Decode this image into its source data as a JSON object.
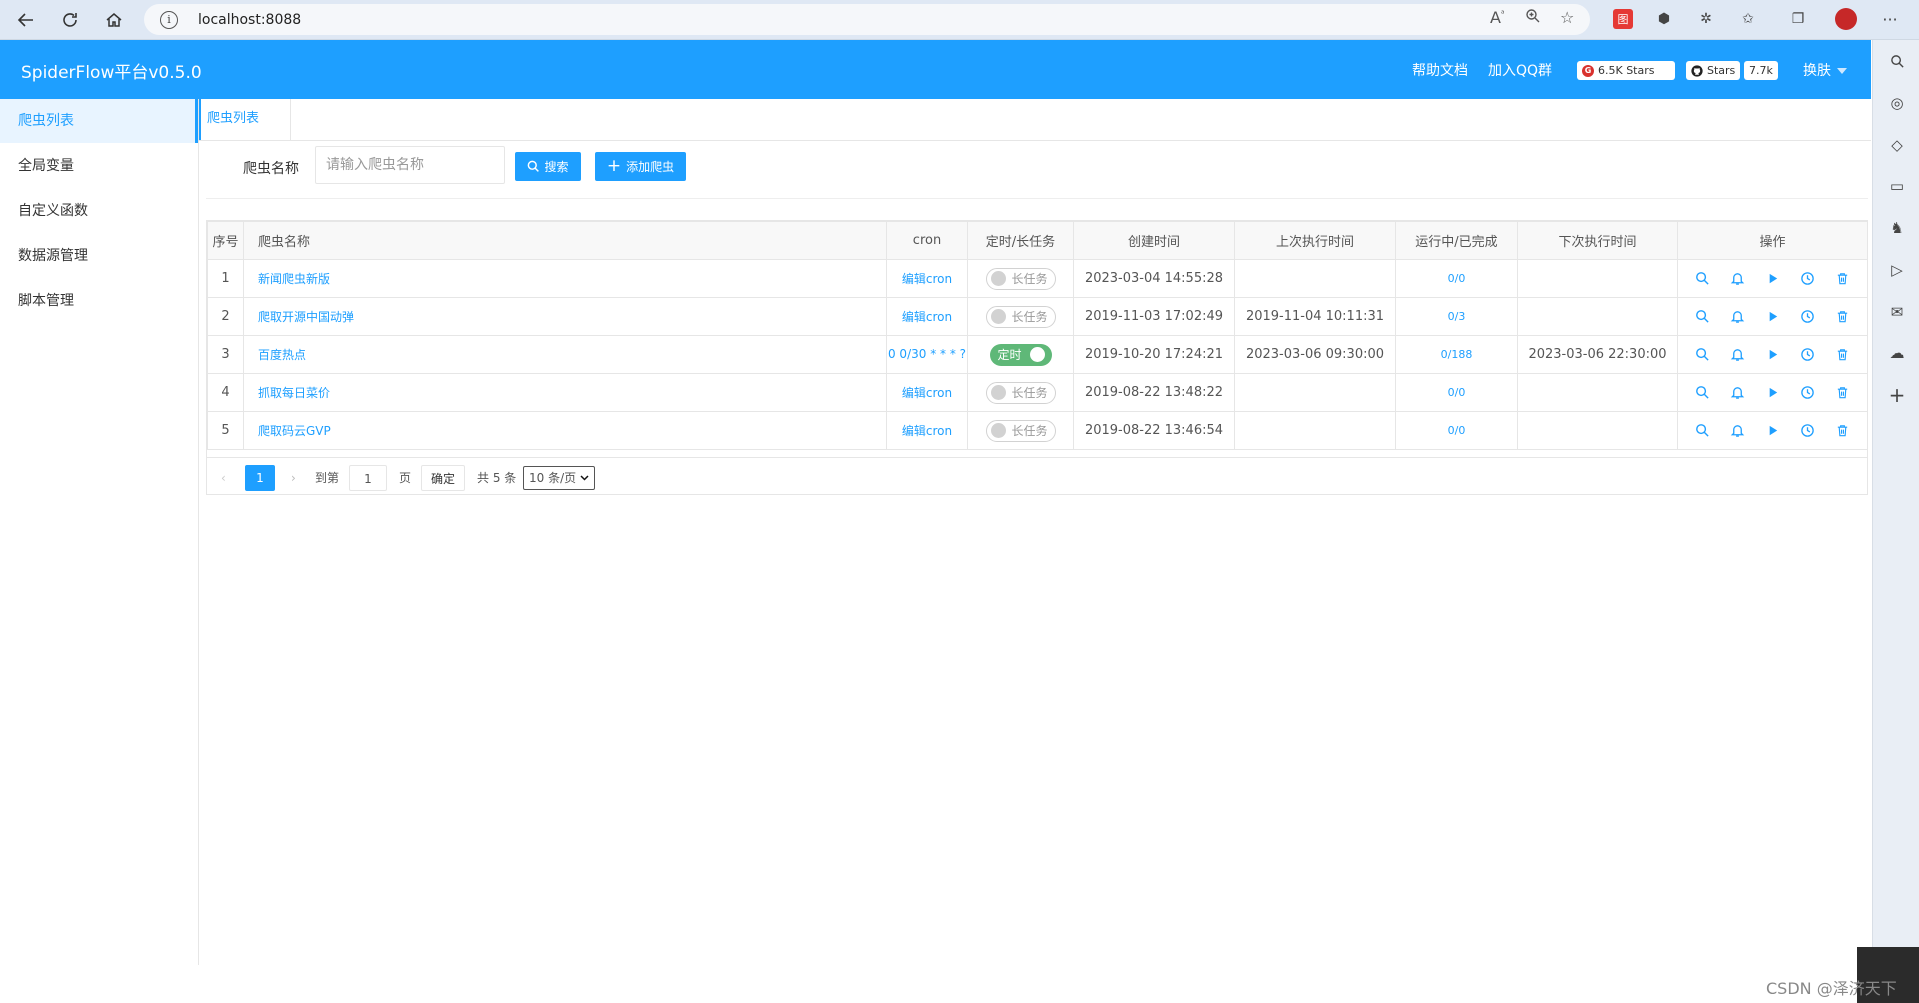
{
  "browser": {
    "url": "localhost:8088",
    "colors": {
      "chrome": "#dfe8f4",
      "address_bar": "#f5f7fa"
    }
  },
  "header": {
    "title": "SpiderFlow平台v0.5.0",
    "links": [
      "帮助文档",
      "加入QQ群"
    ],
    "gitee_badge": "6.5K Stars",
    "github_label": "Stars",
    "github_count": "7.7k",
    "skin": "换肤",
    "color": "#1e9fff"
  },
  "sidebar": {
    "items": [
      {
        "label": "爬虫列表",
        "active": true
      },
      {
        "label": "全局变量",
        "active": false
      },
      {
        "label": "自定义函数",
        "active": false
      },
      {
        "label": "数据源管理",
        "active": false
      },
      {
        "label": "脚本管理",
        "active": false
      }
    ]
  },
  "tab": {
    "label": "爬虫列表"
  },
  "search": {
    "label": "爬虫名称",
    "placeholder": "请输入爬虫名称",
    "search_button": "搜索",
    "add_button": "添加爬虫"
  },
  "table": {
    "headers": [
      "序号",
      "爬虫名称",
      "cron",
      "定时/长任务",
      "创建时间",
      "上次执行时间",
      "运行中/已完成",
      "下次执行时间",
      "操作"
    ],
    "rows": [
      {
        "index": "1",
        "name": "新闻爬虫新版",
        "cron": "编辑cron",
        "mode": "长任务",
        "timed": false,
        "created": "2023-03-04 14:55:28",
        "last_run": "",
        "progress": "0/0",
        "next_run": ""
      },
      {
        "index": "2",
        "name": "爬取开源中国动弹",
        "cron": "编辑cron",
        "mode": "长任务",
        "timed": false,
        "created": "2019-11-03 17:02:49",
        "last_run": "2019-11-04 10:11:31",
        "progress": "0/3",
        "next_run": ""
      },
      {
        "index": "3",
        "name": "百度热点",
        "cron": "0 0/30 * * * ?",
        "mode": "定时",
        "timed": true,
        "created": "2019-10-20 17:24:21",
        "last_run": "2023-03-06 09:30:00",
        "progress": "0/188",
        "next_run": "2023-03-06 22:30:00"
      },
      {
        "index": "4",
        "name": "抓取每日菜价",
        "cron": "编辑cron",
        "mode": "长任务",
        "timed": false,
        "created": "2019-08-22 13:48:22",
        "last_run": "",
        "progress": "0/0",
        "next_run": ""
      },
      {
        "index": "5",
        "name": "爬取码云GVP",
        "cron": "编辑cron",
        "mode": "长任务",
        "timed": false,
        "created": "2019-08-22 13:46:54",
        "last_run": "",
        "progress": "0/0",
        "next_run": ""
      }
    ],
    "ops_icons": [
      "search-icon",
      "bell-icon",
      "play-icon",
      "clock-icon",
      "trash-icon"
    ]
  },
  "pager": {
    "current": "1",
    "goto_label": "到第",
    "goto_value": "1",
    "page_unit": "页",
    "confirm": "确定",
    "total": "共 5 条",
    "page_size": "10 条/页"
  },
  "watermark": "CSDN @泽济天下"
}
